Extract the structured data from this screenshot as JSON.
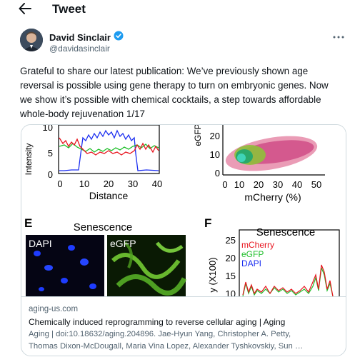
{
  "header": {
    "title": "Tweet",
    "back_icon": "arrow-left-icon"
  },
  "author": {
    "name": "David Sinclair",
    "handle": "@davidasinclair",
    "verified_icon": "verified-badge-icon",
    "more_icon": "more-horizontal-icon",
    "verified_color": "#1d9bf0"
  },
  "tweet": {
    "text_lines": [
      "Grateful to share our latest publication: We’ve previously shown age",
      "reversal is possible using gene therapy to turn on embryonic genes. Now",
      "we show it’s possible with chemical cocktails, a step towards affordable",
      "whole-body rejuvenation 1/17"
    ]
  },
  "card": {
    "domain": "aging-us.com",
    "title": "Chemically induced reprogramming to reverse cellular aging | Aging",
    "desc_line1": "Aging | doi:10.18632/aging.204896. Jae-Hyun Yang, Christopher A. Petty,",
    "desc_line2": "Thomas Dixon-McDougall, Maria Vina Lopez, Alexander Tyshkovskiy, Sun …",
    "figure": {
      "panel_d_ylabel": "Intensity",
      "panel_d_yticks": [
        "10",
        "5",
        "0"
      ],
      "panel_d_xticks": [
        "0",
        "10",
        "20",
        "30",
        "40"
      ],
      "panel_d_xlabel": "Distance",
      "panel_flow_ylabel": "eGFP",
      "panel_flow_yticks": [
        "20",
        "10",
        "0"
      ],
      "panel_flow_xticks": [
        "0",
        "10",
        "20",
        "30",
        "40",
        "50"
      ],
      "panel_flow_xlabel": "mCherry (%)",
      "panel_e_letter": "E",
      "panel_e_title": "Senescence",
      "panel_e_label_dapi": "DAPI",
      "panel_e_label_egfp": "eGFP",
      "panel_f_letter": "F",
      "panel_f_title": "Senescence",
      "panel_f_yticks": [
        "25",
        "20",
        "15",
        "10"
      ],
      "panel_f_ylabel": "y (X100)",
      "panel_f_legend": [
        "mCherry",
        "eGFP",
        "DAPI"
      ],
      "colors": {
        "red": "#e8141e",
        "green": "#1fbf2a",
        "blue": "#1b2ef0"
      }
    }
  }
}
